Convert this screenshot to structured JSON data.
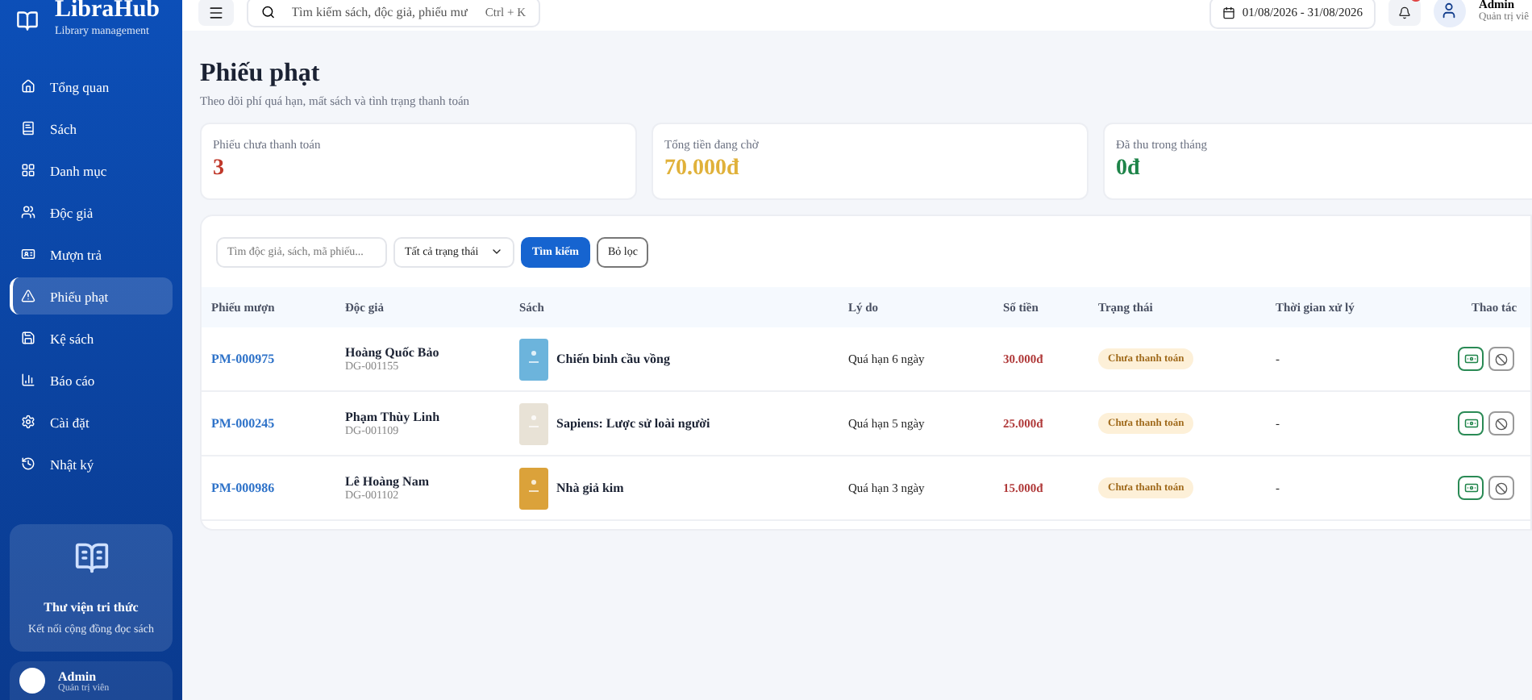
{
  "sidebar": {
    "brand": "LibraHub",
    "tagline": "Library management",
    "items": [
      {
        "label": "Tổng quan",
        "selected": false
      },
      {
        "label": "Sách",
        "selected": false
      },
      {
        "label": "Danh mục",
        "selected": false
      },
      {
        "label": "Độc giả",
        "selected": false
      },
      {
        "label": "Mượn trả",
        "selected": false
      },
      {
        "label": "Phiếu phạt",
        "selected": true
      },
      {
        "label": "Kệ sách",
        "selected": false
      },
      {
        "label": "Báo cáo",
        "selected": false
      },
      {
        "label": "Cài đặt",
        "selected": false
      },
      {
        "label": "Nhật ký",
        "selected": false
      }
    ],
    "promo": {
      "title": "Thư viện tri thức",
      "text": "Kết nối cộng đồng đọc sách"
    },
    "user": {
      "name": "Admin",
      "role": "Quản trị viên"
    }
  },
  "header": {
    "search_placeholder": "Tìm kiếm sách, độc giả, phiếu mư",
    "shortcut": "Ctrl + K",
    "date_range": "01/08/2026 - 31/08/2026",
    "user_name": "Admin",
    "user_role": "Quản trị viê"
  },
  "page": {
    "title": "Phiếu phạt",
    "subtitle": "Theo dõi phí quá hạn, mất sách và tình trạng thanh toán"
  },
  "stats": [
    {
      "label": "Phiếu chưa thanh toán",
      "value": "3",
      "color": "#c0392b"
    },
    {
      "label": "Tổng tiền đang chờ",
      "value": "70.000đ",
      "color": "#e0b13a"
    },
    {
      "label": "Đã thu trong tháng",
      "value": "0đ",
      "color": "#1e8449"
    }
  ],
  "filters": {
    "search_placeholder": "Tìm độc giả, sách, mã phiếu...",
    "status_select": "Tất cả trạng thái",
    "search_button": "Tìm kiếm",
    "reset_button": "Bỏ lọc"
  },
  "table": {
    "columns": [
      "Phiếu mượn",
      "Độc giả",
      "Sách",
      "Lý do",
      "Số tiền",
      "Trạng thái",
      "Thời gian xử lý",
      "Thao tác"
    ],
    "rows": [
      {
        "loan": "PM-000975",
        "reader": "Hoàng Quốc Bảo",
        "reader_id": "DG-001155",
        "book": "Chiến binh cầu vồng",
        "color": "#6cb4dc",
        "reason": "Quá hạn 6 ngày",
        "amount": "30.000đ",
        "status": "Chưa thanh toán",
        "processed": "-"
      },
      {
        "loan": "PM-000245",
        "reader": "Phạm Thùy Linh",
        "reader_id": "DG-001109",
        "book": "Sapiens: Lược sử loài người",
        "color": "#e8e2d6",
        "reason": "Quá hạn 5 ngày",
        "amount": "25.000đ",
        "status": "Chưa thanh toán",
        "processed": "-"
      },
      {
        "loan": "PM-000986",
        "reader": "Lê Hoàng Nam",
        "reader_id": "DG-001102",
        "book": "Nhà giả kim",
        "color": "#dba23a",
        "reason": "Quá hạn 3 ngày",
        "amount": "15.000đ",
        "status": "Chưa thanh toán",
        "processed": "-"
      }
    ]
  }
}
